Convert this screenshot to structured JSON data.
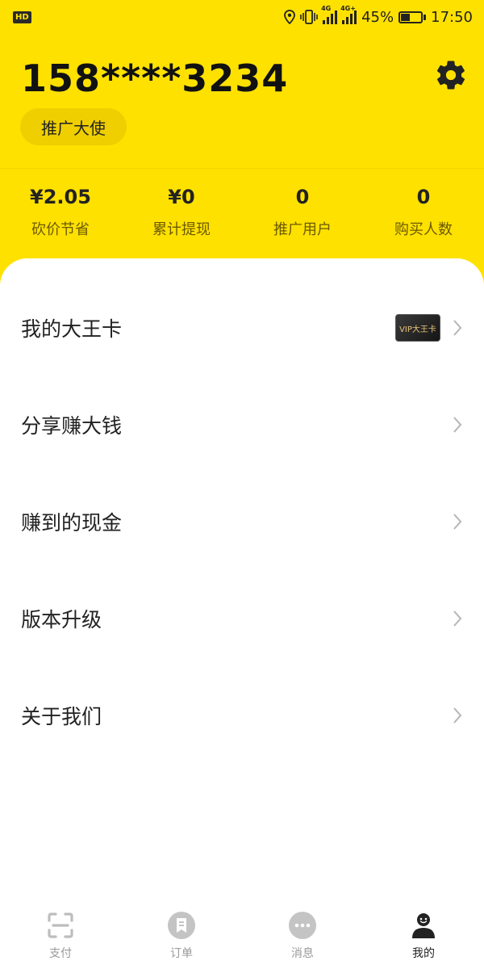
{
  "status_bar": {
    "hd_label": "HD",
    "signal_1": "4G",
    "signal_2": "4G+",
    "battery_percent": "45%",
    "battery_level": 0.45,
    "time": "17:50"
  },
  "profile": {
    "phone": "158****3234",
    "role_badge": "推广大使"
  },
  "stats": [
    {
      "value": "¥2.05",
      "label": "砍价节省"
    },
    {
      "value": "¥0",
      "label": "累计提现"
    },
    {
      "value": "0",
      "label": "推广用户"
    },
    {
      "value": "0",
      "label": "购买人数"
    }
  ],
  "menu": [
    {
      "label": "我的大王卡",
      "has_card": true,
      "card_label": "VIP大王卡"
    },
    {
      "label": "分享赚大钱"
    },
    {
      "label": "赚到的现金"
    },
    {
      "label": "版本升级"
    },
    {
      "label": "关于我们"
    }
  ],
  "tabs": [
    {
      "label": "支付",
      "icon": "scan-icon",
      "active": false
    },
    {
      "label": "订单",
      "icon": "order-icon",
      "active": false
    },
    {
      "label": "消息",
      "icon": "message-icon",
      "active": false
    },
    {
      "label": "我的",
      "icon": "profile-icon",
      "active": true
    }
  ],
  "colors": {
    "brand_yellow": "#ffe100",
    "badge_yellow": "#f0cf00",
    "text_dark": "#222222",
    "tab_inactive": "#999999"
  }
}
